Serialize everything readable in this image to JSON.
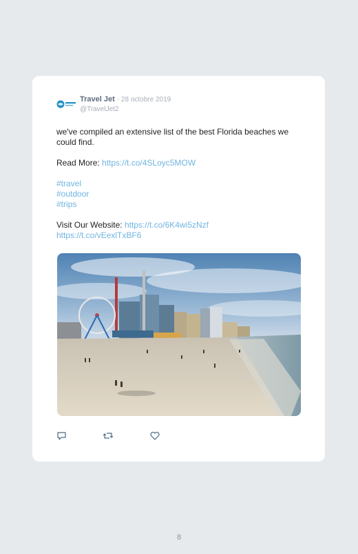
{
  "tweet": {
    "author": "Travel Jet",
    "date": "· 28 octobre 2019",
    "handle": "@TravelJet2",
    "avatar_icon": "travel-jet-logo",
    "text_intro": "we've compiled an extensive list of the best Florida beaches we could find.",
    "read_more_label": "Read More: ",
    "read_more_link": "https://t.co/4SLoyc5MOW",
    "hashtags": [
      "#travel",
      "#outdoor",
      "#trips"
    ],
    "website_label": "Visit Our Website: ",
    "website_link": "https://t.co/6K4wi5zNzf",
    "extra_link": "https://t.co/vEexlTxBF6",
    "image": "beach-photo",
    "actions": [
      "reply-icon",
      "retweet-icon",
      "like-icon"
    ]
  },
  "page_number": "8",
  "colors": {
    "background": "#e6eaed",
    "card": "#ffffff",
    "link": "#6fb4e0"
  }
}
